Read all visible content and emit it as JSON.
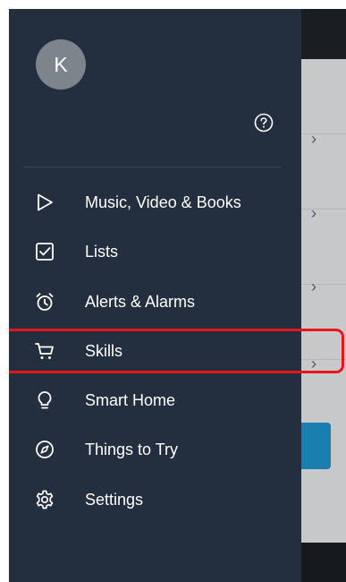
{
  "profile": {
    "initial": "K"
  },
  "menu": [
    {
      "label": "Music, Video & Books",
      "icon": "play-icon"
    },
    {
      "label": "Lists",
      "icon": "checkbox-icon"
    },
    {
      "label": "Alerts & Alarms",
      "icon": "alarm-icon"
    },
    {
      "label": "Skills",
      "icon": "cart-icon"
    },
    {
      "label": "Smart Home",
      "icon": "lightbulb-icon"
    },
    {
      "label": "Things to Try",
      "icon": "compass-icon"
    },
    {
      "label": "Settings",
      "icon": "gear-icon"
    }
  ],
  "highlighted_item": "Skills",
  "colors": {
    "drawer_bg": "#232f3e",
    "highlight": "#e8161c",
    "text": "#ffffff"
  }
}
